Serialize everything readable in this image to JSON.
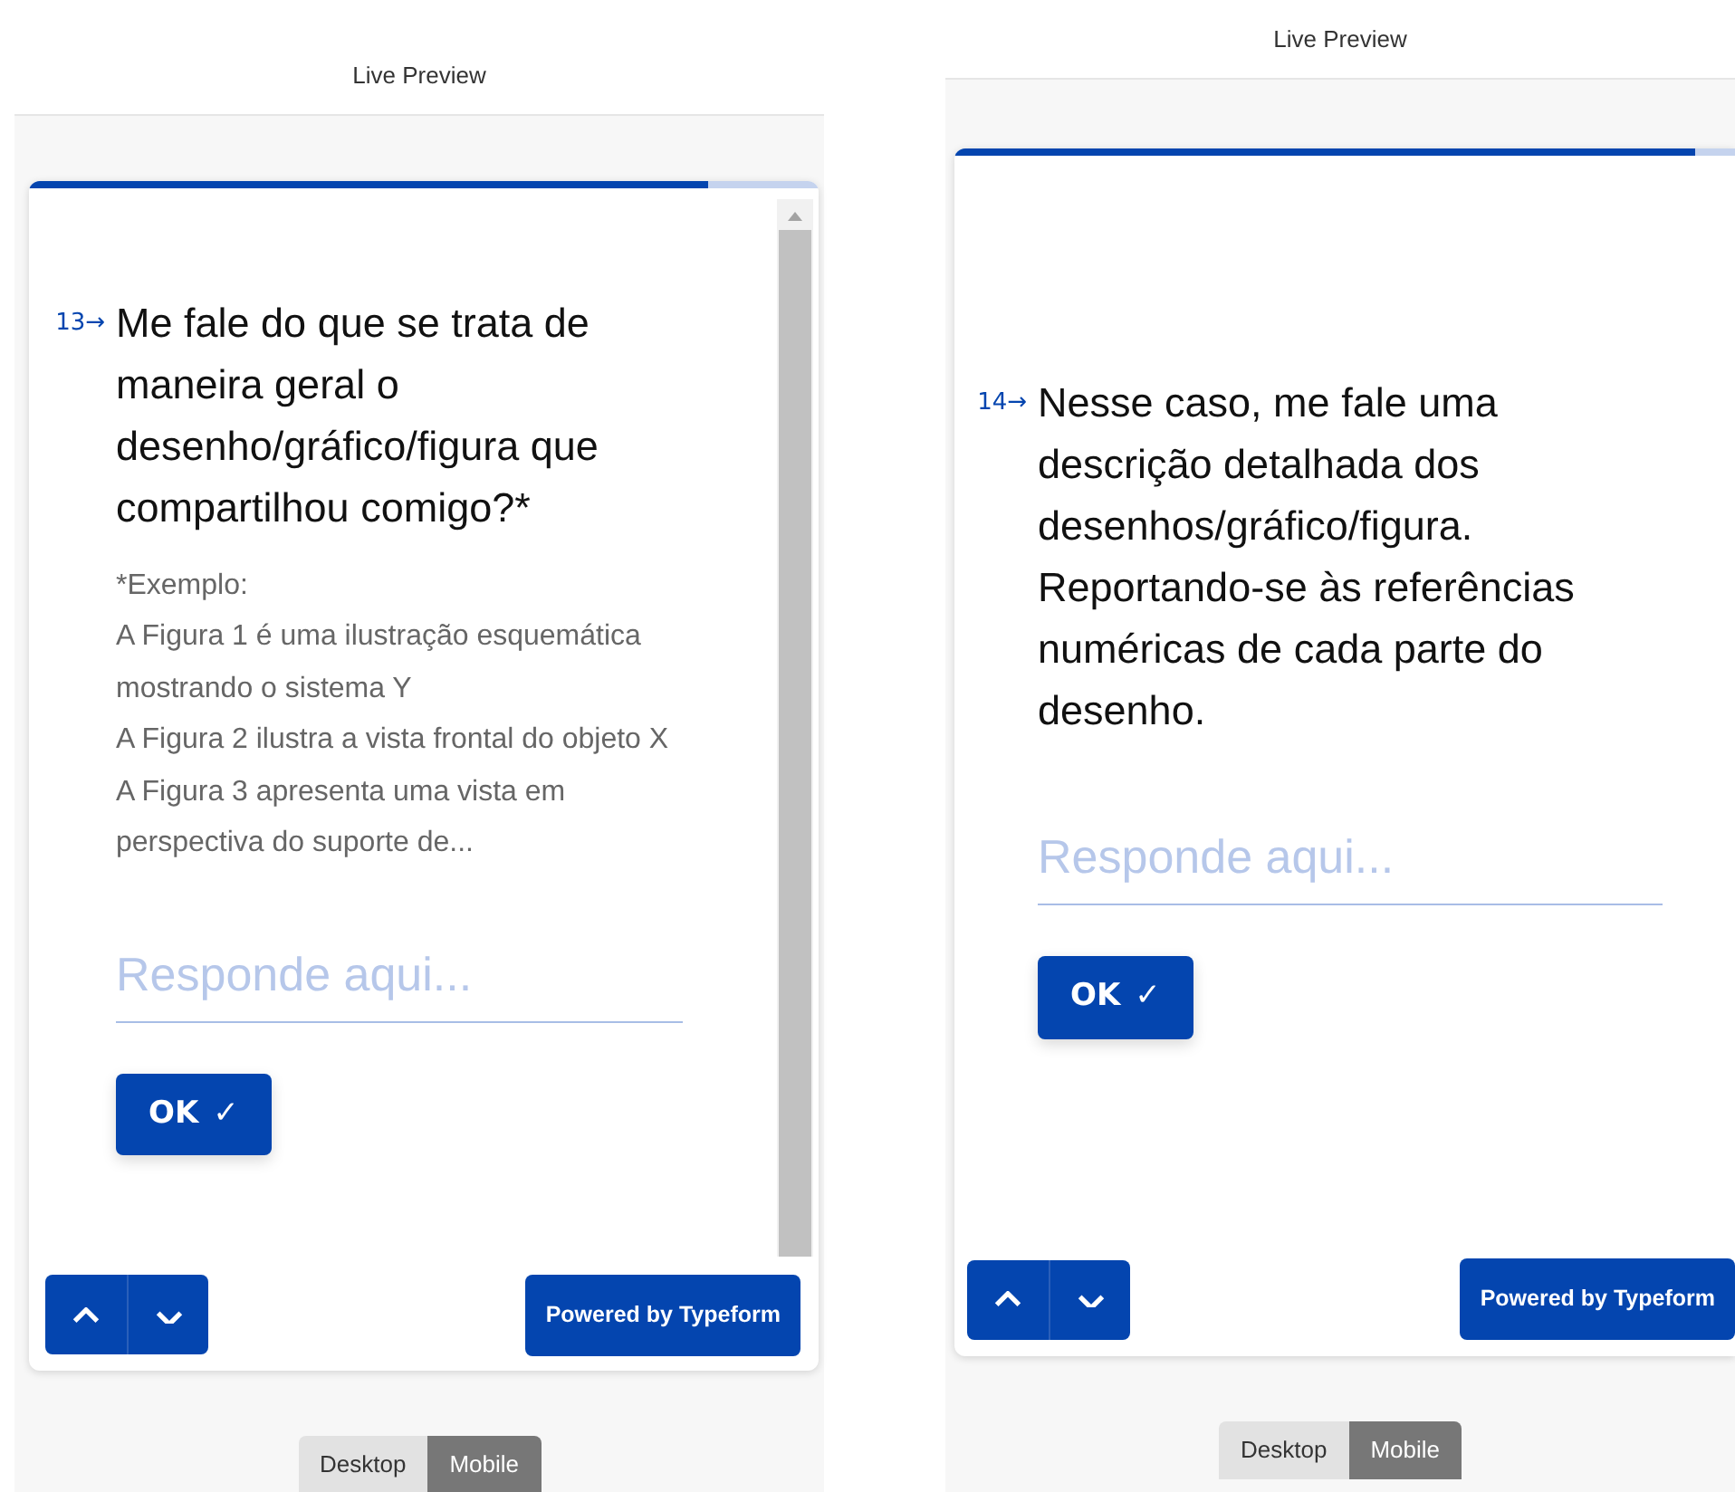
{
  "panels": [
    {
      "header": "Live Preview",
      "progress": {
        "level": 0.86
      },
      "scrollable": true,
      "question": {
        "number": "13",
        "arrow": "→",
        "text": "Me fale do que se trata de maneira geral o desenho/gráfico/figura que compartilhou comigo?*",
        "description": [
          "*Exemplo:",
          "A Figura 1 é uma ilustração esquemática mostrando o sistema Y",
          "A Figura 2 ilustra a vista frontal do objeto X",
          "A Figura 3 apresenta uma vista em perspectiva do suporte de..."
        ]
      },
      "answer": {
        "placeholder": "Responde aqui..."
      },
      "ok_button": {
        "label": "OK",
        "icon": "✓"
      },
      "powered_by": "Powered by Typeform",
      "view_toggle": [
        {
          "label": "Desktop",
          "selected": false
        },
        {
          "label": "Mobile",
          "selected": true
        }
      ]
    },
    {
      "header": "Live Preview",
      "progress": {
        "level": 0.95
      },
      "scrollable": false,
      "question": {
        "number": "14",
        "arrow": "→",
        "text": "Nesse caso, me fale uma descrição detalhada dos desenhos/gráfico/figura. Reportando-se às referências numéricas de cada parte do desenho."
      },
      "answer": {
        "placeholder": "Responde aqui..."
      },
      "ok_button": {
        "label": "OK",
        "icon": "✓"
      },
      "powered_by": "Powered by Typeform",
      "view_toggle": [
        {
          "label": "Desktop",
          "selected": false
        },
        {
          "label": "Mobile",
          "selected": true
        }
      ]
    }
  ]
}
